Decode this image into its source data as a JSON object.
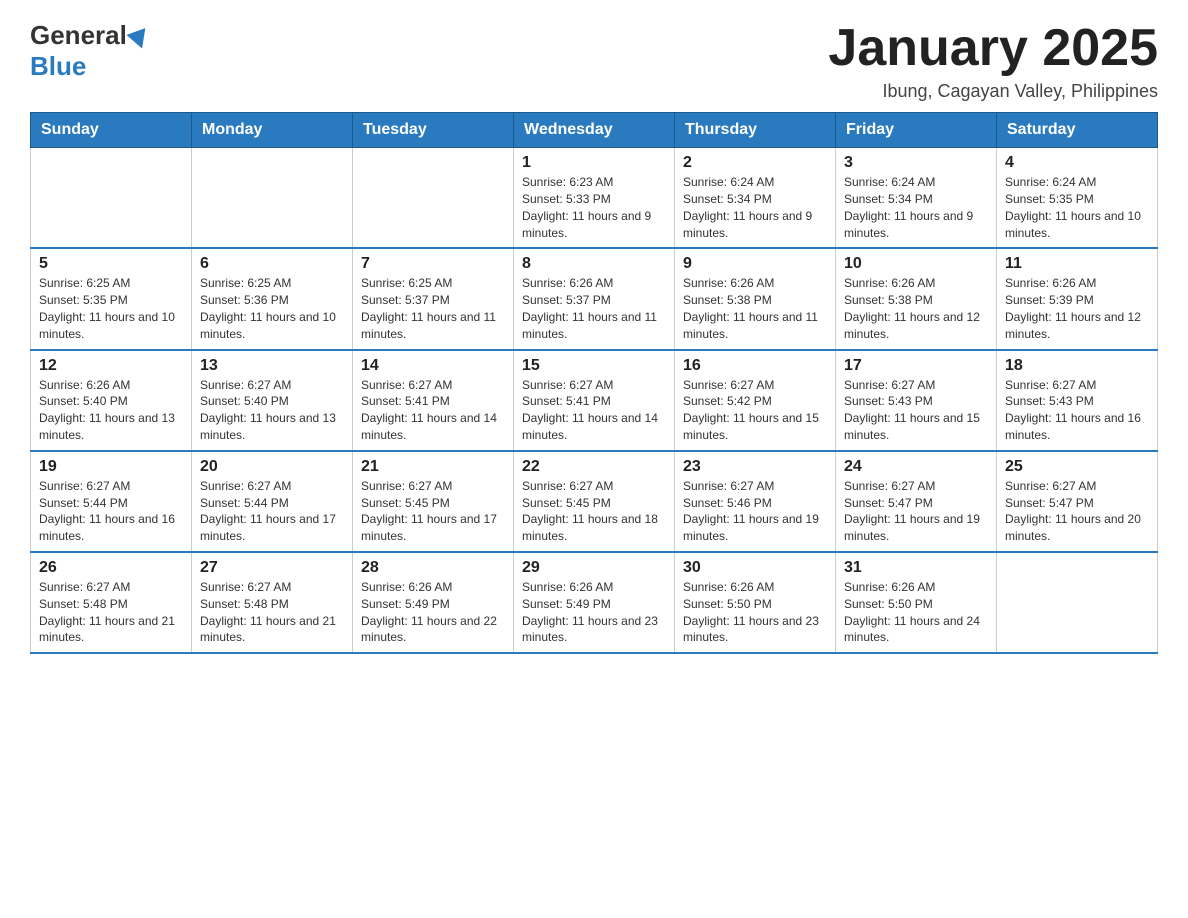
{
  "header": {
    "logo_general": "General",
    "logo_blue": "Blue",
    "month_title": "January 2025",
    "location": "Ibung, Cagayan Valley, Philippines"
  },
  "days_of_week": [
    "Sunday",
    "Monday",
    "Tuesday",
    "Wednesday",
    "Thursday",
    "Friday",
    "Saturday"
  ],
  "weeks": [
    [
      {
        "day": "",
        "info": ""
      },
      {
        "day": "",
        "info": ""
      },
      {
        "day": "",
        "info": ""
      },
      {
        "day": "1",
        "info": "Sunrise: 6:23 AM\nSunset: 5:33 PM\nDaylight: 11 hours and 9 minutes."
      },
      {
        "day": "2",
        "info": "Sunrise: 6:24 AM\nSunset: 5:34 PM\nDaylight: 11 hours and 9 minutes."
      },
      {
        "day": "3",
        "info": "Sunrise: 6:24 AM\nSunset: 5:34 PM\nDaylight: 11 hours and 9 minutes."
      },
      {
        "day": "4",
        "info": "Sunrise: 6:24 AM\nSunset: 5:35 PM\nDaylight: 11 hours and 10 minutes."
      }
    ],
    [
      {
        "day": "5",
        "info": "Sunrise: 6:25 AM\nSunset: 5:35 PM\nDaylight: 11 hours and 10 minutes."
      },
      {
        "day": "6",
        "info": "Sunrise: 6:25 AM\nSunset: 5:36 PM\nDaylight: 11 hours and 10 minutes."
      },
      {
        "day": "7",
        "info": "Sunrise: 6:25 AM\nSunset: 5:37 PM\nDaylight: 11 hours and 11 minutes."
      },
      {
        "day": "8",
        "info": "Sunrise: 6:26 AM\nSunset: 5:37 PM\nDaylight: 11 hours and 11 minutes."
      },
      {
        "day": "9",
        "info": "Sunrise: 6:26 AM\nSunset: 5:38 PM\nDaylight: 11 hours and 11 minutes."
      },
      {
        "day": "10",
        "info": "Sunrise: 6:26 AM\nSunset: 5:38 PM\nDaylight: 11 hours and 12 minutes."
      },
      {
        "day": "11",
        "info": "Sunrise: 6:26 AM\nSunset: 5:39 PM\nDaylight: 11 hours and 12 minutes."
      }
    ],
    [
      {
        "day": "12",
        "info": "Sunrise: 6:26 AM\nSunset: 5:40 PM\nDaylight: 11 hours and 13 minutes."
      },
      {
        "day": "13",
        "info": "Sunrise: 6:27 AM\nSunset: 5:40 PM\nDaylight: 11 hours and 13 minutes."
      },
      {
        "day": "14",
        "info": "Sunrise: 6:27 AM\nSunset: 5:41 PM\nDaylight: 11 hours and 14 minutes."
      },
      {
        "day": "15",
        "info": "Sunrise: 6:27 AM\nSunset: 5:41 PM\nDaylight: 11 hours and 14 minutes."
      },
      {
        "day": "16",
        "info": "Sunrise: 6:27 AM\nSunset: 5:42 PM\nDaylight: 11 hours and 15 minutes."
      },
      {
        "day": "17",
        "info": "Sunrise: 6:27 AM\nSunset: 5:43 PM\nDaylight: 11 hours and 15 minutes."
      },
      {
        "day": "18",
        "info": "Sunrise: 6:27 AM\nSunset: 5:43 PM\nDaylight: 11 hours and 16 minutes."
      }
    ],
    [
      {
        "day": "19",
        "info": "Sunrise: 6:27 AM\nSunset: 5:44 PM\nDaylight: 11 hours and 16 minutes."
      },
      {
        "day": "20",
        "info": "Sunrise: 6:27 AM\nSunset: 5:44 PM\nDaylight: 11 hours and 17 minutes."
      },
      {
        "day": "21",
        "info": "Sunrise: 6:27 AM\nSunset: 5:45 PM\nDaylight: 11 hours and 17 minutes."
      },
      {
        "day": "22",
        "info": "Sunrise: 6:27 AM\nSunset: 5:45 PM\nDaylight: 11 hours and 18 minutes."
      },
      {
        "day": "23",
        "info": "Sunrise: 6:27 AM\nSunset: 5:46 PM\nDaylight: 11 hours and 19 minutes."
      },
      {
        "day": "24",
        "info": "Sunrise: 6:27 AM\nSunset: 5:47 PM\nDaylight: 11 hours and 19 minutes."
      },
      {
        "day": "25",
        "info": "Sunrise: 6:27 AM\nSunset: 5:47 PM\nDaylight: 11 hours and 20 minutes."
      }
    ],
    [
      {
        "day": "26",
        "info": "Sunrise: 6:27 AM\nSunset: 5:48 PM\nDaylight: 11 hours and 21 minutes."
      },
      {
        "day": "27",
        "info": "Sunrise: 6:27 AM\nSunset: 5:48 PM\nDaylight: 11 hours and 21 minutes."
      },
      {
        "day": "28",
        "info": "Sunrise: 6:26 AM\nSunset: 5:49 PM\nDaylight: 11 hours and 22 minutes."
      },
      {
        "day": "29",
        "info": "Sunrise: 6:26 AM\nSunset: 5:49 PM\nDaylight: 11 hours and 23 minutes."
      },
      {
        "day": "30",
        "info": "Sunrise: 6:26 AM\nSunset: 5:50 PM\nDaylight: 11 hours and 23 minutes."
      },
      {
        "day": "31",
        "info": "Sunrise: 6:26 AM\nSunset: 5:50 PM\nDaylight: 11 hours and 24 minutes."
      },
      {
        "day": "",
        "info": ""
      }
    ]
  ]
}
